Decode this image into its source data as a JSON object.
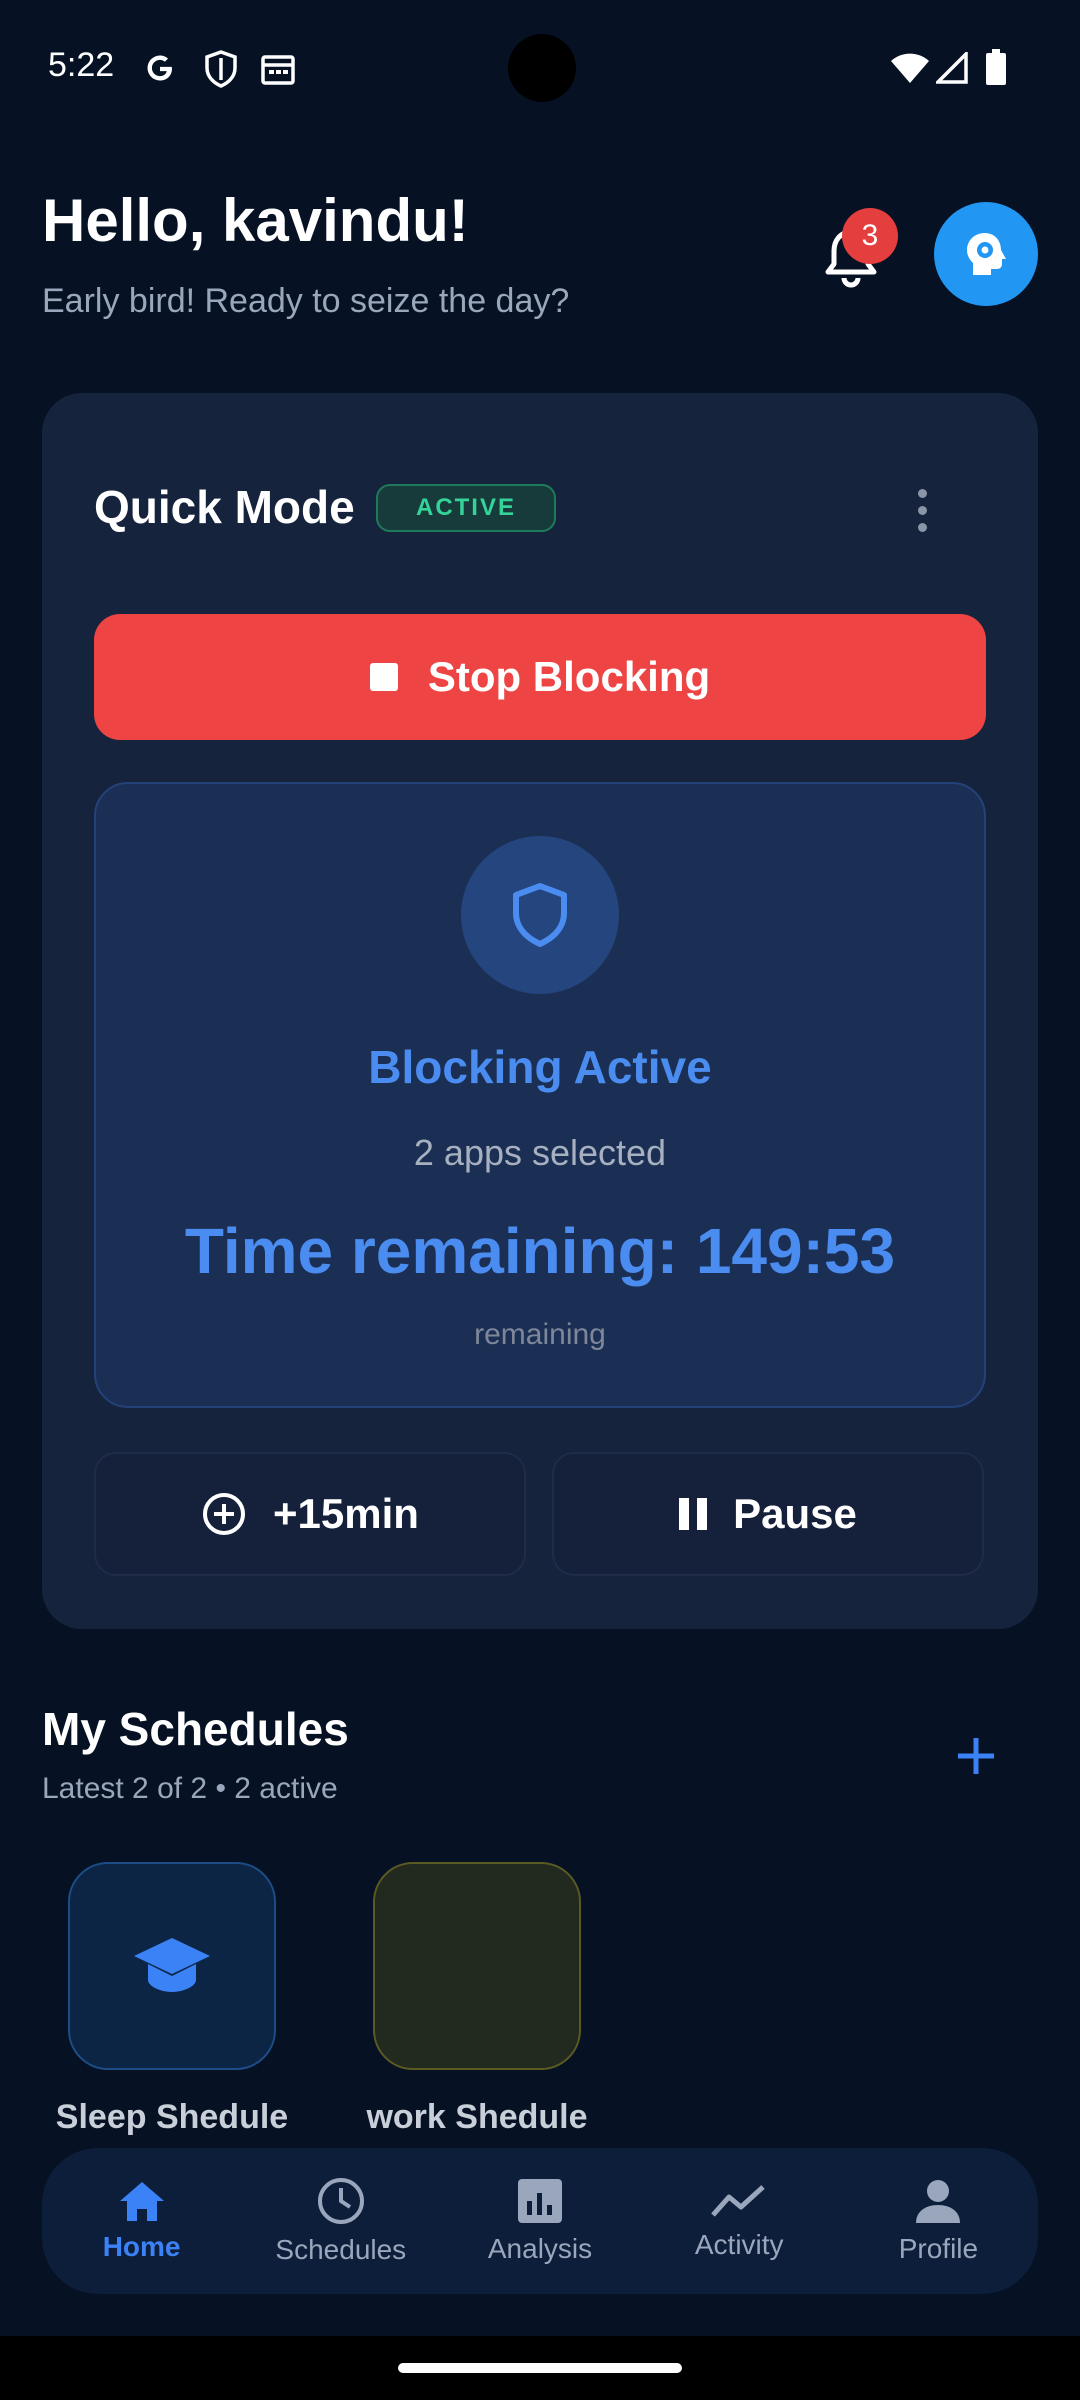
{
  "status_bar": {
    "time": "5:22"
  },
  "header": {
    "greeting": "Hello, kavindu!",
    "subtitle": "Early bird! Ready to seize the day?",
    "notification_count": "3"
  },
  "quick_mode": {
    "title": "Quick Mode",
    "status_pill": "ACTIVE",
    "stop_button": "Stop Blocking",
    "blocking_title": "Blocking Active",
    "apps_selected": "2 apps selected",
    "time_remaining": "Time remaining: 149:53",
    "remaining_label": "remaining",
    "extend_button": "+15min",
    "pause_button": "Pause"
  },
  "schedules": {
    "title": "My Schedules",
    "subtitle": "Latest 2 of 2 • 2 active",
    "items": [
      {
        "label": "Sleep Shedule",
        "icon": "graduation-cap-icon"
      },
      {
        "label": "work Shedule",
        "icon": "moon-icon"
      }
    ]
  },
  "nav": {
    "items": [
      {
        "label": "Home",
        "icon": "home-icon"
      },
      {
        "label": "Schedules",
        "icon": "clock-icon"
      },
      {
        "label": "Analysis",
        "icon": "bar-chart-icon"
      },
      {
        "label": "Activity",
        "icon": "trend-line-icon"
      },
      {
        "label": "Profile",
        "icon": "person-icon"
      }
    ]
  },
  "colors": {
    "background": "#061224",
    "card": "#16233d",
    "accent_blue": "#4a8cf0",
    "danger": "#ef4444",
    "active_green": "#34d399"
  }
}
